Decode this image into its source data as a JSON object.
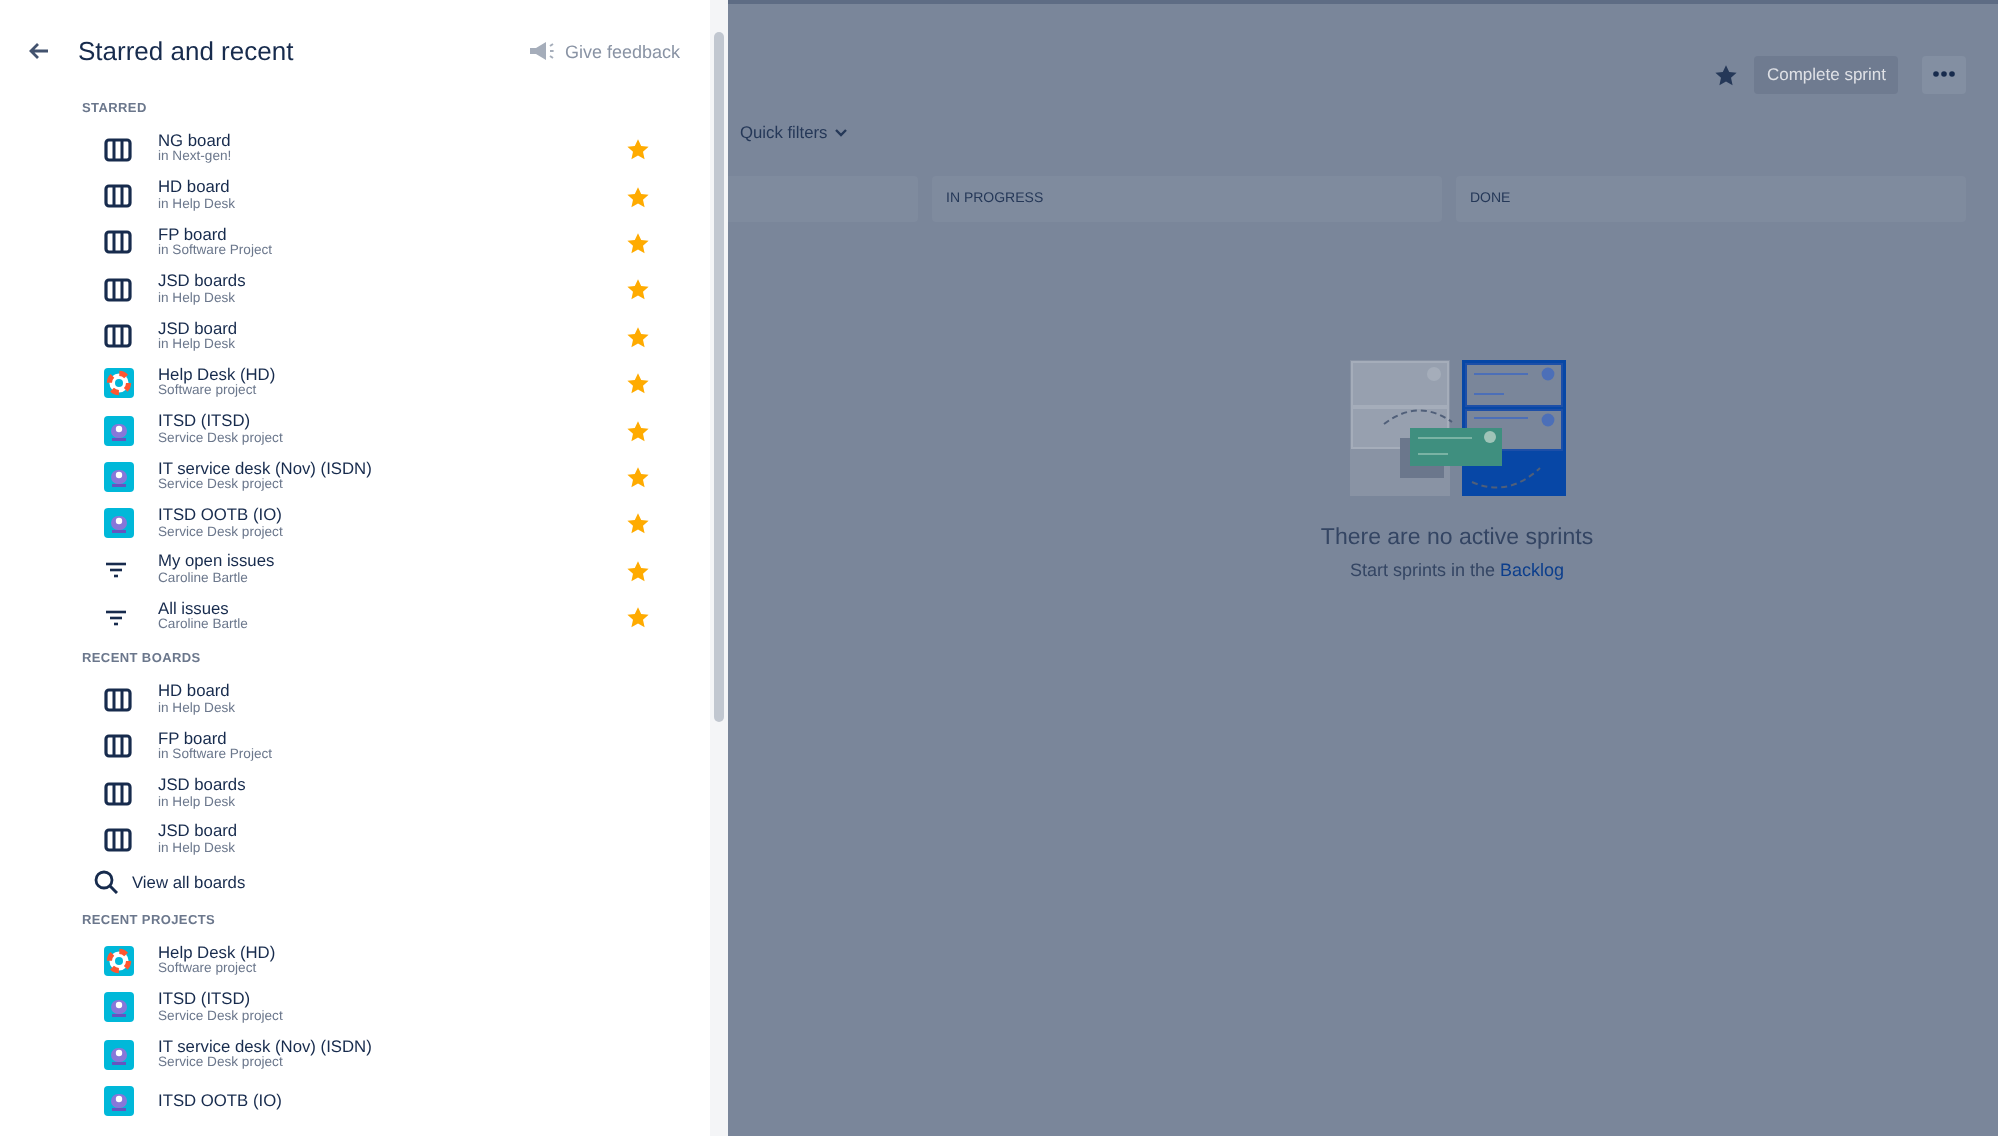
{
  "panel": {
    "title": "Starred and recent",
    "feedback": "Give feedback",
    "sections": [
      {
        "heading": "STARRED",
        "items": [
          {
            "kind": "board",
            "title": "NG board",
            "subtitle": "in Next-gen!",
            "starred": true
          },
          {
            "kind": "board",
            "title": "HD board",
            "subtitle": "in Help Desk",
            "starred": true
          },
          {
            "kind": "board",
            "title": "FP board",
            "subtitle": "in Software Project",
            "starred": true
          },
          {
            "kind": "board",
            "title": "JSD boards",
            "subtitle": "in Help Desk",
            "starred": true
          },
          {
            "kind": "board",
            "title": "JSD board",
            "subtitle": "in Help Desk",
            "starred": true
          },
          {
            "kind": "lifebuoy",
            "title": "Help Desk (HD)",
            "subtitle": "Software project",
            "starred": true
          },
          {
            "kind": "robot",
            "title": "ITSD (ITSD)",
            "subtitle": "Service Desk project",
            "starred": true
          },
          {
            "kind": "robot",
            "title": "IT service desk (Nov) (ISDN)",
            "subtitle": "Service Desk project",
            "starred": true
          },
          {
            "kind": "robot",
            "title": "ITSD OOTB (IO)",
            "subtitle": "Service Desk project",
            "starred": true
          },
          {
            "kind": "filter",
            "title": "My open issues",
            "subtitle": "Caroline Bartle",
            "starred": true
          },
          {
            "kind": "filter",
            "title": "All issues",
            "subtitle": "Caroline Bartle",
            "starred": true
          }
        ]
      },
      {
        "heading": "RECENT BOARDS",
        "items": [
          {
            "kind": "board",
            "title": "HD board",
            "subtitle": "in Help Desk",
            "starred": false
          },
          {
            "kind": "board",
            "title": "FP board",
            "subtitle": "in Software Project",
            "starred": false
          },
          {
            "kind": "board",
            "title": "JSD boards",
            "subtitle": "in Help Desk",
            "starred": false
          },
          {
            "kind": "board",
            "title": "JSD board",
            "subtitle": "in Help Desk",
            "starred": false
          }
        ],
        "view_all": "View all boards"
      },
      {
        "heading": "RECENT PROJECTS",
        "items": [
          {
            "kind": "lifebuoy",
            "title": "Help Desk (HD)",
            "subtitle": "Software project",
            "starred": false
          },
          {
            "kind": "robot",
            "title": "ITSD (ITSD)",
            "subtitle": "Service Desk project",
            "starred": false
          },
          {
            "kind": "robot",
            "title": "IT service desk (Nov) (ISDN)",
            "subtitle": "Service Desk project",
            "starred": false
          },
          {
            "kind": "robot",
            "title": "ITSD OOTB (IO)",
            "starred": false
          }
        ]
      }
    ]
  },
  "board": {
    "complete_button": "Complete sprint",
    "quick_filters": "Quick filters",
    "columns": [
      "IN PROGRESS",
      "DONE"
    ],
    "empty_title": "There are no active sprints",
    "empty_text": "Start sprints in the",
    "empty_link": "Backlog"
  }
}
